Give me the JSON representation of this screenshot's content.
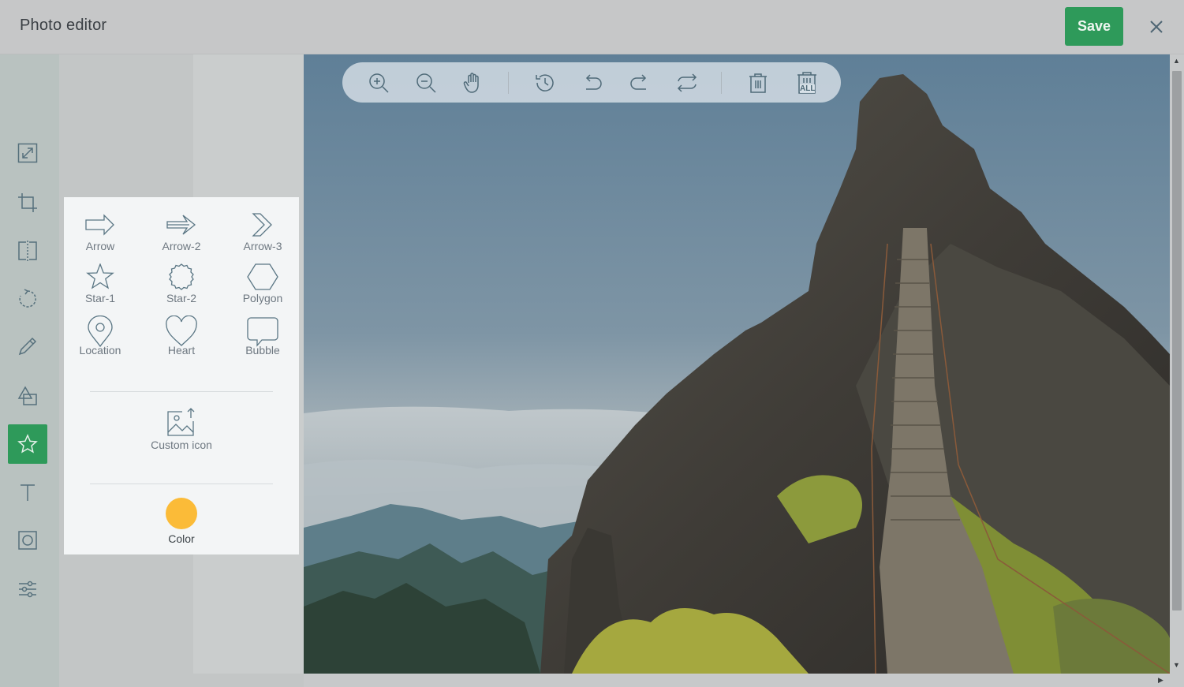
{
  "header": {
    "title": "Photo editor",
    "save_label": "Save"
  },
  "shapes": [
    {
      "label": "Arrow",
      "icon": "arrow-icon"
    },
    {
      "label": "Arrow-2",
      "icon": "arrow-2-icon"
    },
    {
      "label": "Arrow-3",
      "icon": "arrow-3-icon"
    },
    {
      "label": "Star-1",
      "icon": "star-1-icon"
    },
    {
      "label": "Star-2",
      "icon": "star-2-icon"
    },
    {
      "label": "Polygon",
      "icon": "polygon-icon"
    },
    {
      "label": "Location",
      "icon": "location-icon"
    },
    {
      "label": "Heart",
      "icon": "heart-icon"
    },
    {
      "label": "Bubble",
      "icon": "bubble-icon"
    }
  ],
  "custom_icon_label": "Custom icon",
  "color_label": "Color",
  "colors": {
    "accent": "#2e9a5a",
    "selected_color": "#fbbb38"
  },
  "sidebar_tools": [
    "resize-icon",
    "crop-icon",
    "flip-icon",
    "rotate-icon",
    "draw-icon",
    "shape-icon",
    "icon-tool-icon",
    "text-icon",
    "mask-icon",
    "filter-icon"
  ],
  "toolbar": {
    "last_label": "ALL"
  }
}
